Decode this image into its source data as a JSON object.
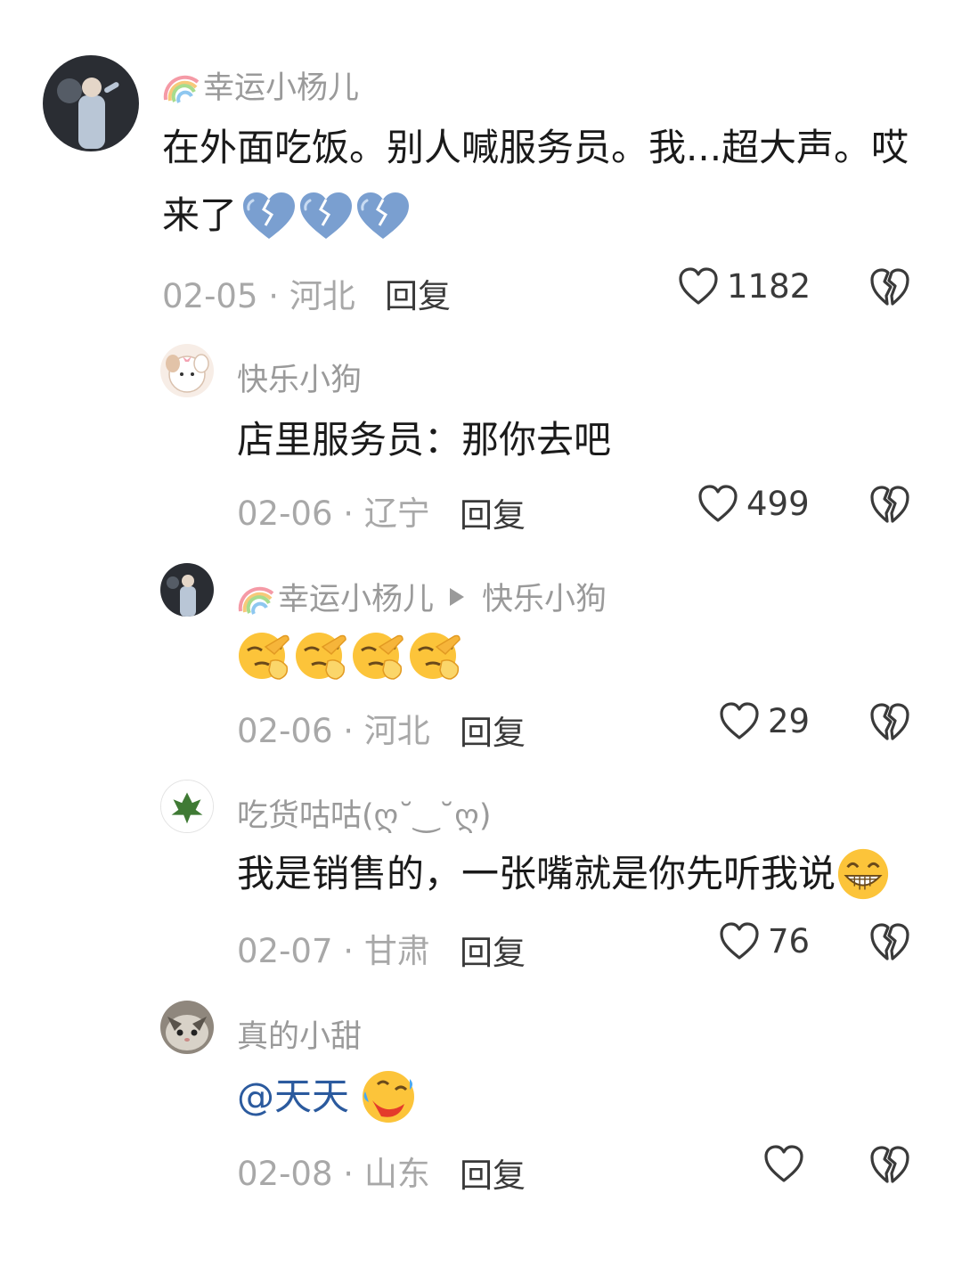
{
  "comments": [
    {
      "user": "幸运小杨儿",
      "text_line1": "在外面吃饭。别人喊服务员。我...超大声。哎",
      "text_line2": "来了",
      "date": "02-05",
      "location": "河北",
      "reply": "回复",
      "likes": "1182",
      "emoji": "broken-heart-blue"
    },
    {
      "user": "快乐小狗",
      "text": "店里服务员：那你去吧",
      "date": "02-06",
      "location": "辽宁",
      "reply": "回复",
      "likes": "499"
    },
    {
      "user": "幸运小杨儿",
      "reply_to": "快乐小狗",
      "date": "02-06",
      "location": "河北",
      "reply": "回复",
      "likes": "29",
      "emoji": "facepalm"
    },
    {
      "user": "吃货咕咕(ღ˘‿˘ღ)",
      "text": "我是销售的，一张嘴就是你先听我说",
      "date": "02-07",
      "location": "甘肃",
      "reply": "回复",
      "likes": "76",
      "emoji": "grinning-face"
    },
    {
      "user": "真的小甜",
      "mention": "@天天",
      "date": "02-08",
      "location": "山东",
      "reply": "回复",
      "likes": "",
      "emoji": "rolling-laughing"
    }
  ],
  "meta_separator": " · ",
  "colors": {
    "meta": "#a8a8a8",
    "username": "#9a9a9a",
    "mention": "#2b5a9e"
  }
}
